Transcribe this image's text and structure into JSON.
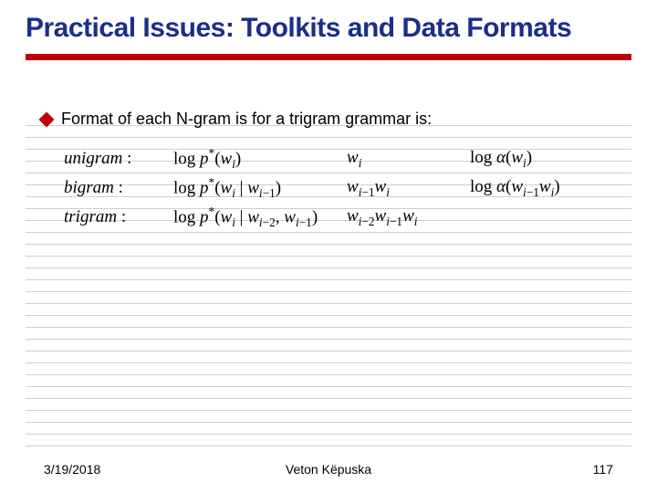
{
  "title": "Practical Issues: Toolkits and Data Formats",
  "bullet": "Format of each N-gram is for a trigram grammar is:",
  "rows": [
    {
      "label": "unigram"
    },
    {
      "label": "bigram"
    },
    {
      "label": "trigram"
    }
  ],
  "footer": {
    "date": "3/19/2018",
    "author": "Veton Këpuska",
    "page": "117"
  }
}
